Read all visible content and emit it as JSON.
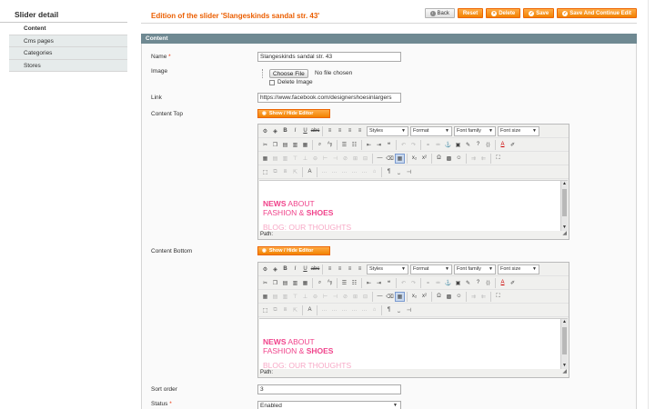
{
  "sidebar": {
    "title": "Slider detail",
    "tabs": [
      {
        "label": "Content",
        "active": true
      },
      {
        "label": "Cms pages",
        "active": false
      },
      {
        "label": "Categories",
        "active": false
      },
      {
        "label": "Stores",
        "active": false
      }
    ]
  },
  "header": {
    "title": "Edition of the slider 'Slangeskinds sandal str. 43'",
    "buttons": {
      "back": "Back",
      "reset": "Reset",
      "delete": "Delete",
      "save": "Save",
      "save_continue": "Save And Continue Edit"
    },
    "accent": "#eb5e00"
  },
  "section": {
    "title": "Content",
    "color": "#6f8992"
  },
  "form": {
    "name": {
      "label": "Name",
      "required_mark": "*",
      "value": "Slangeskinds sandal str. 43"
    },
    "image": {
      "label": "Image",
      "choose_label": "Choose File",
      "no_file": "No file chosen",
      "delete_label": "Delete Image"
    },
    "link": {
      "label": "Link",
      "value": "https://www.facebook.com/designershoesinlargers"
    },
    "content_top": {
      "label": "Content Top"
    },
    "content_bottom": {
      "label": "Content Bottom"
    },
    "sort_order": {
      "label": "Sort order",
      "value": "3"
    },
    "status": {
      "label": "Status",
      "required_mark": "*",
      "value": "Enabled"
    }
  },
  "editor": {
    "toggle_label": "Show / Hide Editor",
    "selects": {
      "styles": "Styles",
      "format": "Format",
      "font_family": "Font family",
      "font_size": "Font size"
    },
    "content": {
      "news": "NEWS",
      "about": "ABOUT",
      "fashion": "FASHION &",
      "shoes": "SHOES",
      "blog": "BLOG",
      "thoughts": ": OUR THOUGHTS"
    },
    "path_label": "Path:"
  },
  "icons": {
    "back": "back-arrow-icon",
    "reset": "reset-icon",
    "delete": "delete-icon",
    "save": "check-icon",
    "scroll": "scrollbar-icon"
  }
}
